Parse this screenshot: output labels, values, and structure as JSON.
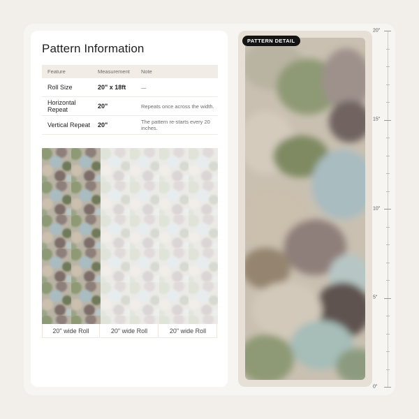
{
  "info": {
    "title": "Pattern Information",
    "headers": [
      "Feature",
      "Measurement",
      "Note"
    ],
    "rows": [
      {
        "feature": "Roll Size",
        "measurement": "20\" x 18ft",
        "note": "—"
      },
      {
        "feature": "Horizontal Repeat",
        "measurement": "20\"",
        "note": "Repeats once across the width."
      },
      {
        "feature": "Vertical Repeat",
        "measurement": "20\"",
        "note": "The pattern re-starts every 20 inches."
      }
    ]
  },
  "rolls": {
    "labels": [
      "20\" wide Roll",
      "20\" wide Roll",
      "20\" wide Roll"
    ]
  },
  "detail": {
    "badge": "PATTERN DETAIL"
  },
  "ruler": {
    "labels": [
      "20\"",
      "15\"",
      "10\"",
      "5\"",
      "0\""
    ]
  },
  "colors": {
    "background": "#f2efea",
    "card": "#ffffff",
    "header_row": "#f1ede6",
    "badge": "#141414",
    "sage": "#8e9a74",
    "mauve": "#8f7f7a",
    "sky": "#a9bcc0",
    "sand": "#cbbfae"
  }
}
